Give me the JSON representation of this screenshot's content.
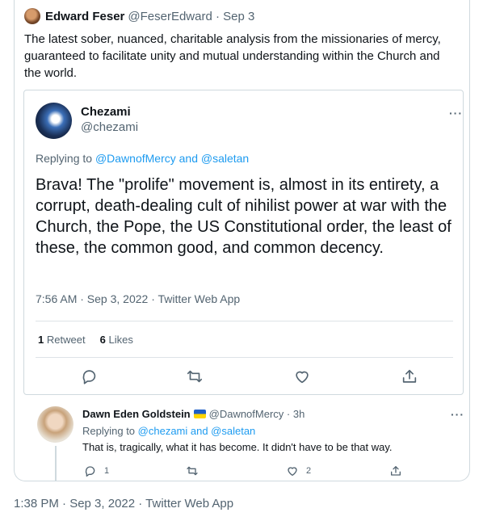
{
  "main_tweet": {
    "author_name": "Edward Feser",
    "author_meta": "@FeserEdward · Sep 3",
    "text": "The latest sober, nuanced, charitable analysis from the missionaries of mercy, guaranteed to facilitate unity and mutual understanding within the Church and the world."
  },
  "quoted_tweet": {
    "name": "Chezami",
    "handle": "@chezami",
    "replying_prefix": "Replying to ",
    "replying_links": "@DawnofMercy and @saletan",
    "text": "Brava!  The \"prolife\" movement is, almost in its entirety, a corrupt, death-dealing cult of nihilist power at war with the Church, the Pope, the US Constitutional order, the least of these, the common good, and common decency.",
    "timestamp": "7:56 AM · Sep 3, 2022 · Twitter Web App",
    "retweets_count": "1",
    "retweets_label": "Retweet",
    "likes_count": "6",
    "likes_label": "Likes",
    "more": "···"
  },
  "reply": {
    "name": "Dawn Eden Goldstein",
    "handle_meta": "@DawnofMercy · 3h",
    "replying_prefix": "Replying to ",
    "replying_links": "@chezami and @saletan",
    "text": "That is, tragically, what it has become. It didn't have to be that way.",
    "reply_count": "1",
    "like_count": "2",
    "more": "···"
  },
  "footer_timestamp": "1:38 PM · Sep 3, 2022 · Twitter Web App"
}
